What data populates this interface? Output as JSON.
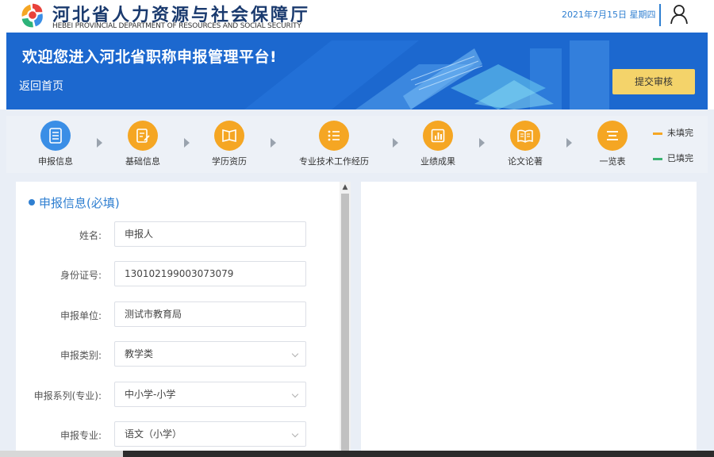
{
  "header": {
    "org_name_cn": "河北省人力资源与社会保障厅",
    "org_name_en": "HEBEI PROVINCIAL DEPARTMENT OF RESOURCES AND SOCIAL SECURITY",
    "date": "2021年7月15日 星期四"
  },
  "banner": {
    "title": "欢迎您进入河北省职称申报管理平台!",
    "back_link": "返回首页",
    "submit_button": "提交审核"
  },
  "steps": [
    {
      "label": "申报信息",
      "icon": "document-list-icon",
      "color": "#3a8ee6"
    },
    {
      "label": "基础信息",
      "icon": "edit-document-icon",
      "color": "#f5a623"
    },
    {
      "label": "学历资历",
      "icon": "book-icon",
      "color": "#f5a623"
    },
    {
      "label": "专业技术工作经历",
      "icon": "list-icon",
      "color": "#f5a623"
    },
    {
      "label": "业绩成果",
      "icon": "chart-icon",
      "color": "#f5a623"
    },
    {
      "label": "论文论著",
      "icon": "open-book-icon",
      "color": "#f5a623"
    },
    {
      "label": "一览表",
      "icon": "menu-icon",
      "color": "#f5a623"
    }
  ],
  "legend": {
    "unfilled": {
      "label": "未填完",
      "color": "#f5a623"
    },
    "filled": {
      "label": "已填完",
      "color": "#3cb371"
    }
  },
  "form": {
    "section_title": "申报信息(必填)",
    "fields": [
      {
        "label": "姓名:",
        "value": "申报人",
        "type": "text"
      },
      {
        "label": "身份证号:",
        "value": "130102199003073079",
        "type": "text"
      },
      {
        "label": "申报单位:",
        "value": "测试市教育局",
        "type": "text"
      },
      {
        "label": "申报类别:",
        "value": "教学类",
        "type": "select"
      },
      {
        "label": "申报系列(专业):",
        "value": "中小学-小学",
        "type": "select"
      },
      {
        "label": "申报专业:",
        "value": "语文（小学）",
        "type": "select"
      }
    ]
  },
  "colors": {
    "brand_blue": "#1c68cf",
    "accent_blue": "#2f7fd1",
    "submit_yellow": "#f4d36a",
    "step_orange": "#f5a623"
  }
}
